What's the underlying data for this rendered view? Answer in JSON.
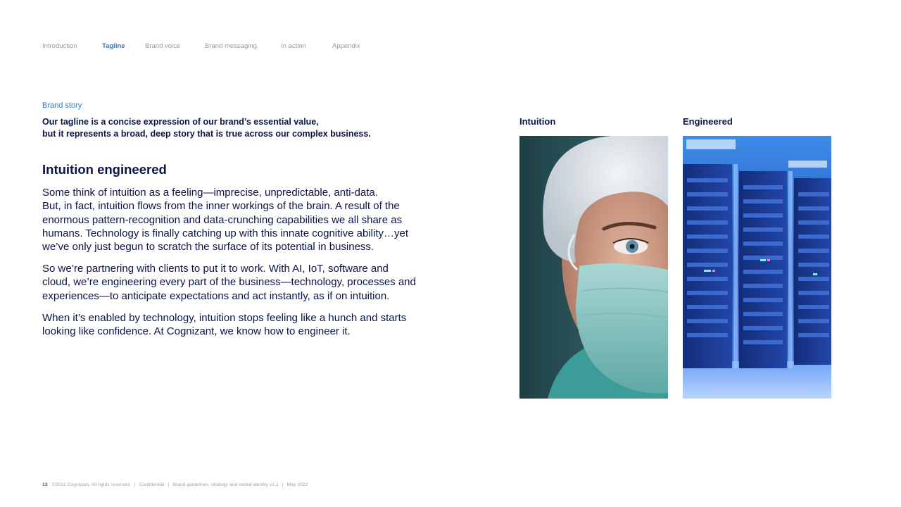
{
  "nav": {
    "items": [
      {
        "label": "Introduction"
      },
      {
        "label": "Tagline"
      },
      {
        "label": "Brand voice"
      },
      {
        "label": "Brand messaging"
      },
      {
        "label": "In action"
      },
      {
        "label": "Appendix"
      }
    ],
    "active": "Tagline"
  },
  "eyebrow": "Brand story",
  "intro": {
    "line1": "Our tagline is a concise expression of our brand’s essential value,",
    "line2": "but it represents a broad, deep story that is true across our complex business."
  },
  "heading": "Intuition engineered",
  "paragraphs": {
    "p1": [
      "Some think of intuition as a feeling—imprecise, unpredictable, anti-data.",
      "But, in fact, intuition flows from the inner workings of the brain. A result of the",
      "enormous pattern-recognition and data-crunching capabilities we all share as",
      "humans. Technology is finally catching up with this innate cognitive ability…yet",
      "we’ve only just begun to scratch the surface of its potential in business."
    ],
    "p2": [
      "So we’re partnering with clients to put it to work. With AI, IoT, software and",
      "cloud, we’re engineering every part of the business—technology, processes and",
      "experiences—to anticipate expectations and act instantly, as if on intuition."
    ],
    "p3": [
      "When it’s enabled by technology, intuition stops feeling like a hunch and starts",
      "looking like confidence. At Cognizant, we know how to engineer it."
    ]
  },
  "images": {
    "left_label": "Intuition",
    "right_label": "Engineered"
  },
  "footer": {
    "page": "13",
    "copyright": "©2022 Cognizant.  All rights reserved.",
    "confidential": "Confidential",
    "doc": "Brand guidelines: strategy and verbal identity v1.1",
    "date": "May 2022"
  },
  "colors": {
    "accent": "#2f78c4",
    "navy": "#0b1446"
  }
}
